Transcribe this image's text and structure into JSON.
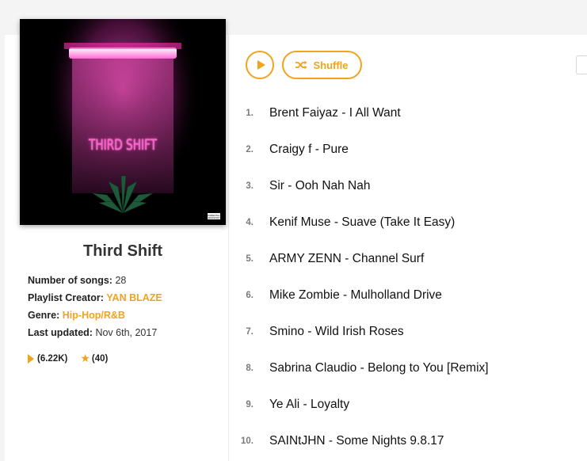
{
  "playlist": {
    "title": "Third Shift",
    "cover_text": "THIRD SHIFT",
    "advisory_text": "PARENTAL ADVISORY",
    "meta": {
      "songs_label": "Number of songs:",
      "songs_value": "28",
      "creator_label": "Playlist Creator:",
      "creator_value": "YAN BLAZE",
      "genre_label": "Genre:",
      "genre_value": "Hip-Hop/R&B",
      "updated_label": "Last updated:",
      "updated_value": "Nov 6th, 2017"
    },
    "stats": {
      "plays": "(6.22K)",
      "favorites": "(40)"
    }
  },
  "controls": {
    "shuffle_label": "Shuffle"
  },
  "colors": {
    "accent": "#f2a31b",
    "neon": "#ff3fc0"
  },
  "icons": {
    "play": "play-icon",
    "shuffle": "shuffle-icon",
    "star": "star-icon"
  },
  "tracks": [
    {
      "num": "1.",
      "title": "Brent Faiyaz - I All Want"
    },
    {
      "num": "2.",
      "title": "Craigy f - Pure"
    },
    {
      "num": "3.",
      "title": "Sir - Ooh Nah Nah"
    },
    {
      "num": "4.",
      "title": "Kenif Muse - Suave (Take It Easy)"
    },
    {
      "num": "5.",
      "title": "ARMY ZENN - Channel Surf"
    },
    {
      "num": "6.",
      "title": "Mike Zombie - Mulholland Drive"
    },
    {
      "num": "7.",
      "title": "Smino - Wild Irish Roses"
    },
    {
      "num": "8.",
      "title": "Sabrina Claudio - Belong to You [Remix]"
    },
    {
      "num": "9.",
      "title": "Ye Ali - Loyalty"
    },
    {
      "num": "10.",
      "title": "SAINtJHN - Some Nights 9.8.17"
    }
  ]
}
